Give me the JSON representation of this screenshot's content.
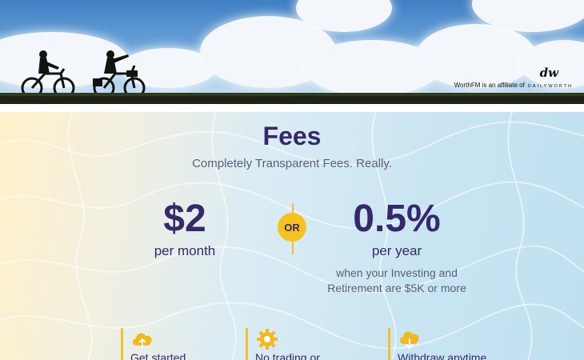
{
  "hero": {
    "affiliate_text": "WorthFM is an affiliate of",
    "affiliate_brand": "DAILYWORTH",
    "brand_mark": "dw"
  },
  "fees": {
    "title": "Fees",
    "subtitle": "Completely Transparent Fees. Really.",
    "monthly": {
      "price": "$2",
      "period": "per month"
    },
    "or_label": "OR",
    "yearly": {
      "price": "0.5%",
      "period": "per year",
      "note_line1": "when your Investing and",
      "note_line2": "Retirement are $5K or more"
    }
  },
  "features": [
    {
      "label": "Get started",
      "icon": "cloud-upload-icon"
    },
    {
      "label": "No trading or",
      "icon": "gear-icon"
    },
    {
      "label": "Withdraw anytime",
      "icon": "cloud-download-icon"
    }
  ],
  "colors": {
    "primary": "#35296b",
    "accent": "#f7c21f",
    "muted": "#5a5f7a"
  }
}
